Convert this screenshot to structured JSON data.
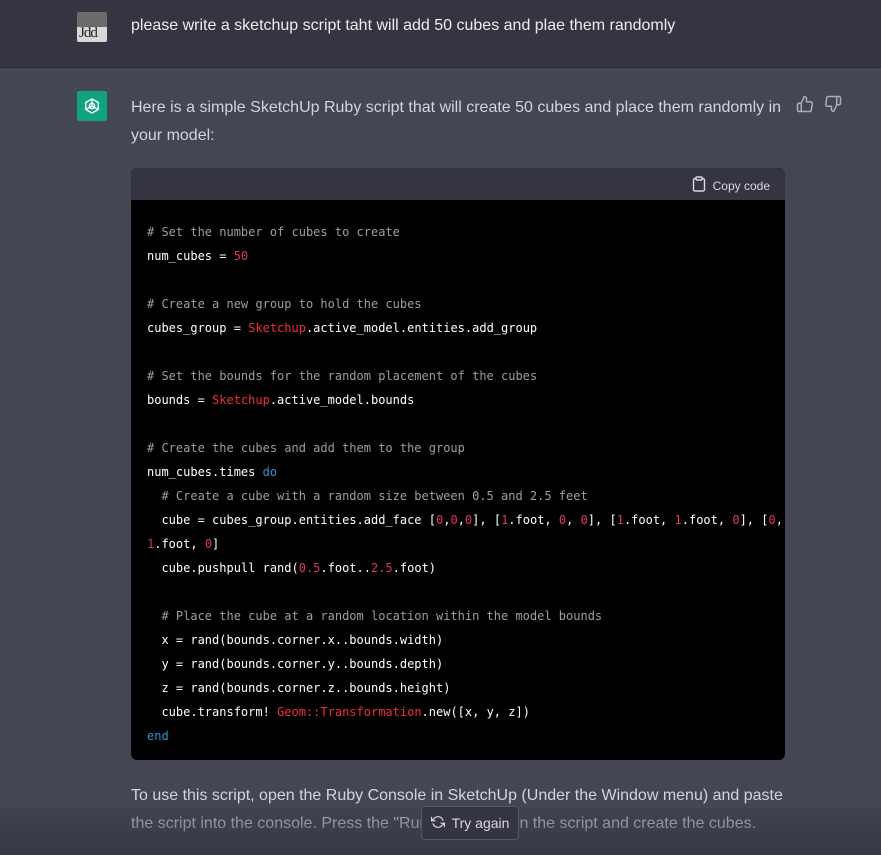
{
  "user": {
    "avatar_text": "Jdd",
    "message": "please write a sketchup script taht will add 50 cubes and plae them randomly"
  },
  "assistant": {
    "intro": "Here is a simple SketchUp Ruby script that will create 50 cubes and place them randomly in your model:",
    "code_header": {
      "copy_label": "Copy code"
    },
    "code_lines": [
      [
        {
          "t": "# Set the number of cubes to create",
          "c": "cm"
        }
      ],
      [
        {
          "t": "num_cubes = ",
          "c": ""
        },
        {
          "t": "50",
          "c": "num"
        }
      ],
      [],
      [
        {
          "t": "# Create a new group to hold the cubes",
          "c": "cm"
        }
      ],
      [
        {
          "t": "cubes_group = ",
          "c": ""
        },
        {
          "t": "Sketchup",
          "c": "cls"
        },
        {
          "t": ".active_model.entities.add_group",
          "c": ""
        }
      ],
      [],
      [
        {
          "t": "# Set the bounds for the random placement of the cubes",
          "c": "cm"
        }
      ],
      [
        {
          "t": "bounds = ",
          "c": ""
        },
        {
          "t": "Sketchup",
          "c": "cls"
        },
        {
          "t": ".active_model.bounds",
          "c": ""
        }
      ],
      [],
      [
        {
          "t": "# Create the cubes and add them to the group",
          "c": "cm"
        }
      ],
      [
        {
          "t": "num_cubes.times ",
          "c": ""
        },
        {
          "t": "do",
          "c": "kw"
        }
      ],
      [
        {
          "t": "  # Create a cube with a random size between 0.5 and 2.5 feet",
          "c": "cm"
        }
      ],
      [
        {
          "t": "  cube = cubes_group.entities.add_face [",
          "c": ""
        },
        {
          "t": "0",
          "c": "num"
        },
        {
          "t": ",",
          "c": ""
        },
        {
          "t": "0",
          "c": "num"
        },
        {
          "t": ",",
          "c": ""
        },
        {
          "t": "0",
          "c": "num"
        },
        {
          "t": "], [",
          "c": ""
        },
        {
          "t": "1",
          "c": "num"
        },
        {
          "t": ".foot, ",
          "c": ""
        },
        {
          "t": "0",
          "c": "num"
        },
        {
          "t": ", ",
          "c": ""
        },
        {
          "t": "0",
          "c": "num"
        },
        {
          "t": "], [",
          "c": ""
        },
        {
          "t": "1",
          "c": "num"
        },
        {
          "t": ".foot, ",
          "c": ""
        },
        {
          "t": "1",
          "c": "num"
        },
        {
          "t": ".foot, ",
          "c": ""
        },
        {
          "t": "0",
          "c": "num"
        },
        {
          "t": "], [",
          "c": ""
        },
        {
          "t": "0",
          "c": "num"
        },
        {
          "t": ",",
          "c": ""
        }
      ],
      [
        {
          "t": "1",
          "c": "num"
        },
        {
          "t": ".foot, ",
          "c": ""
        },
        {
          "t": "0",
          "c": "num"
        },
        {
          "t": "]",
          "c": ""
        }
      ],
      [
        {
          "t": "  cube.pushpull rand(",
          "c": ""
        },
        {
          "t": "0.5",
          "c": "num"
        },
        {
          "t": ".foot..",
          "c": ""
        },
        {
          "t": "2.5",
          "c": "num"
        },
        {
          "t": ".foot)",
          "c": ""
        }
      ],
      [],
      [
        {
          "t": "  # Place the cube at a random location within the model bounds",
          "c": "cm"
        }
      ],
      [
        {
          "t": "  x = rand(bounds.corner.x..bounds.width)",
          "c": ""
        }
      ],
      [
        {
          "t": "  y = rand(bounds.corner.y..bounds.depth)",
          "c": ""
        }
      ],
      [
        {
          "t": "  z = rand(bounds.corner.z..bounds.height)",
          "c": ""
        }
      ],
      [
        {
          "t": "  cube.transform! ",
          "c": ""
        },
        {
          "t": "Geom::Transformation",
          "c": "cls"
        },
        {
          "t": ".new([x, y, z])",
          "c": ""
        }
      ],
      [
        {
          "t": "end",
          "c": "kw"
        }
      ]
    ],
    "outro": "To use this script, open the Ruby Console in SketchUp (Under the Window menu) and paste the script into the console. Press the \"Run\" button to run the script and create the cubes."
  },
  "actions": {
    "try_again_label": "Try again"
  },
  "colors": {
    "bot_accent": "#10a37f",
    "panel_bg": "#444654",
    "code_bg": "#000000"
  },
  "icons": [
    "openai-logo-icon",
    "thumbs-up-icon",
    "thumbs-down-icon",
    "clipboard-icon",
    "refresh-icon"
  ]
}
